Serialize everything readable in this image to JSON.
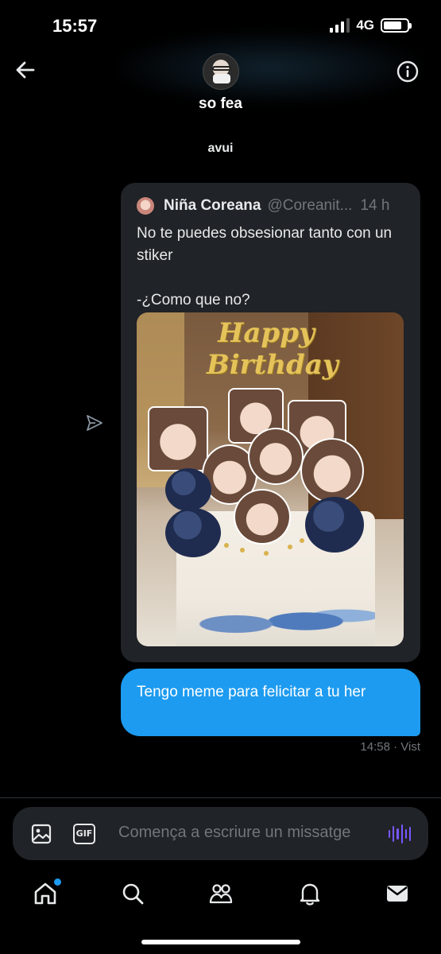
{
  "status_bar": {
    "time": "15:57",
    "network": "4G",
    "battery_level": 0.8,
    "signal_bars_active": 3
  },
  "header": {
    "contact_name": "so fea",
    "back_icon": "arrow-left-icon",
    "info_icon": "info-icon"
  },
  "conversation": {
    "day_separator": "avui",
    "quoted_post": {
      "author_name": "Niña Coreana",
      "author_handle": "@Coreanit...",
      "time_ago": "14 h",
      "text": "No te puedes obsesionar tanto con un stiker\n\n-¿Como que no?",
      "photo_text": "Happy Birthday"
    },
    "sent_message": {
      "text": "Tengo meme para felicitar a tu her",
      "meta": "14:58 · Vist"
    },
    "share_icon": "paper-plane-icon"
  },
  "composer": {
    "placeholder": "Comença a escriure un missatge",
    "gif_label": "GIF",
    "media_icon": "image-icon",
    "voice_icon": "voice-wave-icon"
  },
  "tabbar": {
    "items": [
      {
        "icon": "home-icon",
        "has_badge": true
      },
      {
        "icon": "search-icon"
      },
      {
        "icon": "communities-icon"
      },
      {
        "icon": "bell-icon"
      },
      {
        "icon": "mail-icon",
        "active": true
      }
    ]
  },
  "colors": {
    "background": "#000000",
    "accent_blue": "#1d9bf0",
    "card_bg": "#202327",
    "muted_text": "#71767b",
    "voice_purple": "#7856ff"
  }
}
